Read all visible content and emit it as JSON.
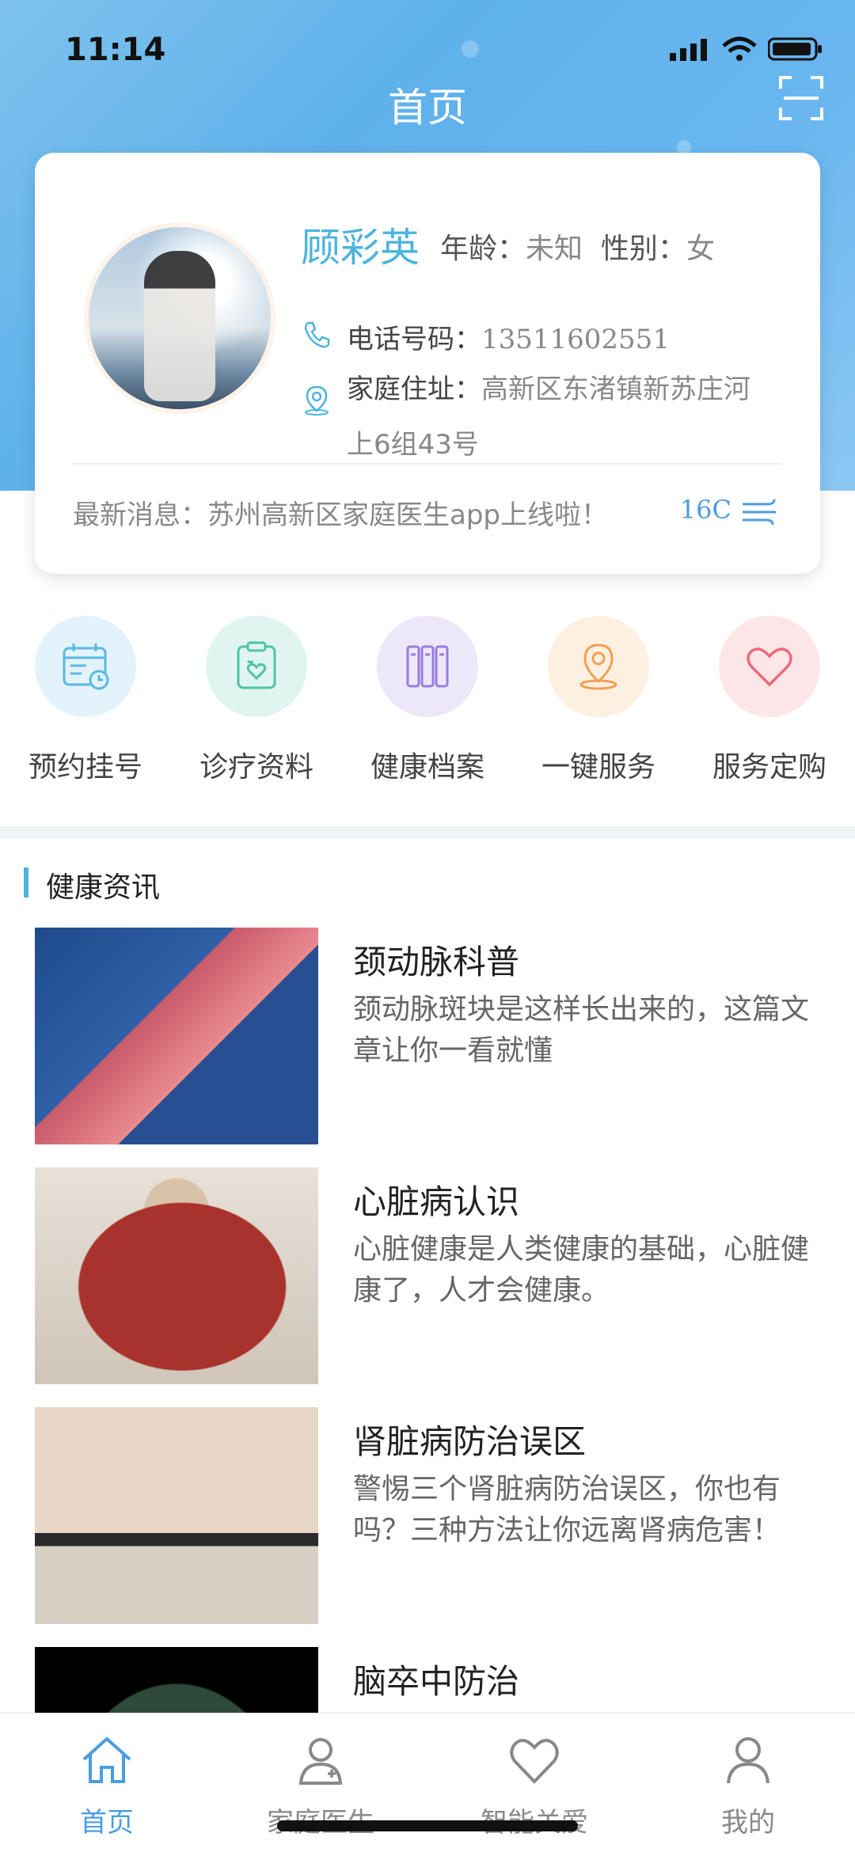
{
  "status": {
    "time": "11:14"
  },
  "header": {
    "title": "首页",
    "scan_icon": "scan-icon"
  },
  "profile": {
    "name": "顾彩英",
    "age_label": "年龄：",
    "age_value": "未知",
    "gender_label": "性别：",
    "gender_value": "女",
    "phone_label": "电话号码：",
    "phone_value": "13511602551",
    "address_label": "家庭住址：",
    "address_value": "高新区东渚镇新苏庄河上6组43号",
    "news_label": "最新消息：",
    "news_value": "苏州高新区家庭医生app上线啦！",
    "temperature": "16C"
  },
  "services": [
    {
      "label": "预约挂号",
      "icon": "calendar-icon",
      "bg": "#e3f3fb",
      "color": "#5bb8e6"
    },
    {
      "label": "诊疗资料",
      "icon": "clipboard-heart-icon",
      "bg": "#e0f5ef",
      "color": "#4ec3a6"
    },
    {
      "label": "健康档案",
      "icon": "folders-icon",
      "bg": "#ece8fa",
      "color": "#9a7be0"
    },
    {
      "label": "一键服务",
      "icon": "location-pin-icon",
      "bg": "#fdf0e0",
      "color": "#f0a050"
    },
    {
      "label": "服务定购",
      "icon": "heart-icon",
      "bg": "#fde6e8",
      "color": "#ef6a7a"
    }
  ],
  "section": {
    "title": "健康资讯"
  },
  "articles": [
    {
      "title": "颈动脉科普",
      "desc": "颈动脉斑块是这样长出来的，这篇文章让你一看就懂"
    },
    {
      "title": "心脏病认识",
      "desc": "心脏健康是人类健康的基础，心脏健康了，人才会健康。"
    },
    {
      "title": "肾脏病防治误区",
      "desc": "警惕三个肾脏病防治误区，你也有吗？三种方法让你远离肾病危害！"
    },
    {
      "title": "脑卒中防治",
      "desc": ""
    }
  ],
  "tabs": [
    {
      "label": "首页",
      "icon": "home-icon",
      "active": true
    },
    {
      "label": "家庭医生",
      "icon": "doctor-icon",
      "active": false
    },
    {
      "label": "智能关爱",
      "icon": "heart-outline-icon",
      "active": false
    },
    {
      "label": "我的",
      "icon": "user-icon",
      "active": false
    }
  ],
  "colors": {
    "accent": "#4db4de",
    "active_tab": "#4a9de0"
  }
}
